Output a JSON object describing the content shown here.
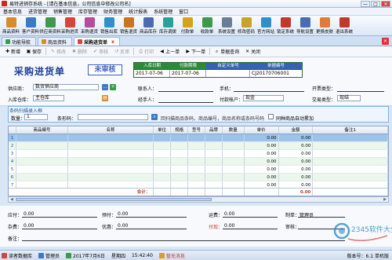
{
  "window": {
    "title": "易特进销存系统 - [请在基本信息，公司信息中修改公司名]",
    "btn_min": "—",
    "btn_max": "□",
    "btn_close": "✕"
  },
  "menu": [
    "基本信息",
    "进货管理",
    "销售管理",
    "库存管理",
    "财务管理",
    "统计报表",
    "系统管理",
    "窗口"
  ],
  "iconbar": [
    {
      "label": "商品资料",
      "icon": "box-icon",
      "color": "#d98b2b"
    },
    {
      "label": "客户资料",
      "icon": "user-icon",
      "color": "#3a7bc8"
    },
    {
      "label": "供应商资料",
      "icon": "factory-icon",
      "color": "#3d9a4a"
    },
    {
      "label": "采购进货",
      "icon": "cart-icon",
      "color": "#d9443a"
    },
    {
      "label": "采购退货",
      "icon": "return-icon",
      "color": "#b54c9d"
    },
    {
      "label": "销售出库",
      "icon": "truck-icon",
      "color": "#2e8fc9"
    },
    {
      "label": "销售退货",
      "icon": "undo-icon",
      "color": "#c9741f"
    },
    {
      "label": "商品库存",
      "icon": "warehouse-icon",
      "color": "#4c6bb5"
    },
    {
      "label": "库存调拨",
      "icon": "transfer-icon",
      "color": "#2aa198"
    },
    {
      "label": "付款单",
      "icon": "pay-icon",
      "color": "#d6a21c"
    },
    {
      "label": "收款单",
      "icon": "receive-icon",
      "color": "#3d9a4a"
    },
    {
      "label": "系统设置",
      "icon": "gear-icon",
      "color": "#6a7d96"
    },
    {
      "label": "修改密码",
      "icon": "key-icon",
      "color": "#c9a227"
    },
    {
      "label": "官方网站",
      "icon": "globe-icon",
      "color": "#2e8fc9"
    },
    {
      "label": "锁定系统",
      "icon": "lock-icon",
      "color": "#c0392b"
    },
    {
      "label": "导航设置",
      "icon": "nav-icon",
      "color": "#4c6bb5"
    },
    {
      "label": "更换皮肤",
      "icon": "skin-icon",
      "color": "#e07b39"
    },
    {
      "label": "退出系统",
      "icon": "exit-icon",
      "color": "#c0392b"
    }
  ],
  "tabs": [
    {
      "label": "功能导航",
      "color": "#3d9a4a",
      "active": false
    },
    {
      "label": "商品资料",
      "color": "#d98b2b",
      "active": false
    },
    {
      "label": "采购进货单",
      "color": "#d9443a",
      "active": true
    }
  ],
  "tab_close": "x",
  "doc_toolbar": [
    {
      "label": "新增",
      "glyph": "✚",
      "enabled": true
    },
    {
      "label": "保存",
      "glyph": "▣",
      "enabled": true
    },
    {
      "label": "修改",
      "glyph": "✎",
      "enabled": false
    },
    {
      "label": "删除",
      "glyph": "✖",
      "enabled": false
    },
    {
      "label": "审核",
      "glyph": "✔",
      "enabled": false
    },
    {
      "label": "反审",
      "glyph": "↺",
      "enabled": false
    },
    {
      "label": "打印",
      "glyph": "⎙",
      "enabled": false
    },
    {
      "label": "上一单",
      "glyph": "◀",
      "enabled": true
    },
    {
      "label": "下一单",
      "glyph": "▶",
      "enabled": true
    },
    {
      "label": "单据查询",
      "glyph": "⌕",
      "enabled": true
    },
    {
      "label": "关闭",
      "glyph": "✕",
      "enabled": true
    }
  ],
  "document": {
    "title": "采购进货单",
    "status": "未审核",
    "info_headers": [
      "入库日期",
      "付款期限",
      "自定义单号",
      "单据编号"
    ],
    "info_values": [
      "2017-07-06",
      "2017-07-06",
      "",
      "CJ20170706001"
    ]
  },
  "form": {
    "supplier_label": "供应商：",
    "supplier": "数贸供应商",
    "contact_label": "联系人：",
    "contact": "",
    "phone_label": "手机：",
    "phone": "",
    "invoice_label": "开票类型：",
    "invoice": "",
    "warehouse_label": "入库仓库：",
    "warehouse": "主仓库",
    "handler_label": "经手人：",
    "handler": "",
    "account_label": "付款帐户：",
    "account": "现金",
    "trade_label": "交易类型：",
    "trade": "现结"
  },
  "scan": {
    "caption": "条码扫描录入框",
    "qty_label": "数量：",
    "qty": "1",
    "barcode_label": "条形码：",
    "barcode": "",
    "hint": "回扫描商品条码，商品编号，商品名称或条码号码",
    "auto_add": "同种商品自动累加"
  },
  "grid": {
    "columns": [
      "商品编号",
      "名称",
      "单位",
      "规格",
      "型号",
      "品牌",
      "数量",
      "单价",
      "金额",
      "备注1"
    ],
    "rows": [
      {
        "no": "1",
        "cells": [
          "",
          "",
          "",
          "",
          "",
          "",
          "",
          "0.00",
          "0.00",
          ""
        ]
      },
      {
        "no": "2",
        "cells": [
          "",
          "",
          "",
          "",
          "",
          "",
          "",
          "0.00",
          "0.00",
          ""
        ]
      },
      {
        "no": "3",
        "cells": [
          "",
          "",
          "",
          "",
          "",
          "",
          "",
          "0.00",
          "0.00",
          ""
        ]
      },
      {
        "no": "4",
        "cells": [
          "",
          "",
          "",
          "",
          "",
          "",
          "",
          "0.00",
          "0.00",
          ""
        ]
      },
      {
        "no": "5",
        "cells": [
          "",
          "",
          "",
          "",
          "",
          "",
          "",
          "0.00",
          "0.00",
          ""
        ]
      },
      {
        "no": "6",
        "cells": [
          "",
          "",
          "",
          "",
          "",
          "",
          "",
          "0.00",
          "0.00",
          ""
        ]
      },
      {
        "no": "7",
        "cells": [
          "",
          "",
          "",
          "",
          "",
          "",
          "",
          "0.00",
          "0.00",
          ""
        ]
      }
    ],
    "total_label": "合计：",
    "total_amount": "0.00"
  },
  "footer": {
    "payable_label": "应付：",
    "payable": "0.00",
    "prepay_label": "预付：",
    "prepay": "0.00",
    "freight_label": "运费：",
    "freight": "0.00",
    "maker_label": "制单：",
    "maker": "管理员",
    "misc_label": "杂费：",
    "misc": "0.00",
    "discount_label": "优惠：",
    "discount": "0.00",
    "paid_label": "付现：",
    "paid": "0.00",
    "auditor_label": "审核：",
    "auditor": "",
    "remark_label": "备注：",
    "remark": ""
  },
  "statusbar": {
    "db": "读者数据库",
    "user": "管理员",
    "date": "2017年7月6日",
    "weekday": "星期四",
    "time": "15:42:40",
    "msg": "暂无消息",
    "version": "版本号：6.1 单机版"
  },
  "watermark": "2345软件大全",
  "colors": {
    "accent": "#1e3e9e",
    "audit": "#3f5fbf",
    "total": "#c0392b",
    "selected_row": "#9cc4ea",
    "alt_row": "#eaf7ea",
    "header_green": "#2a6e2a"
  }
}
